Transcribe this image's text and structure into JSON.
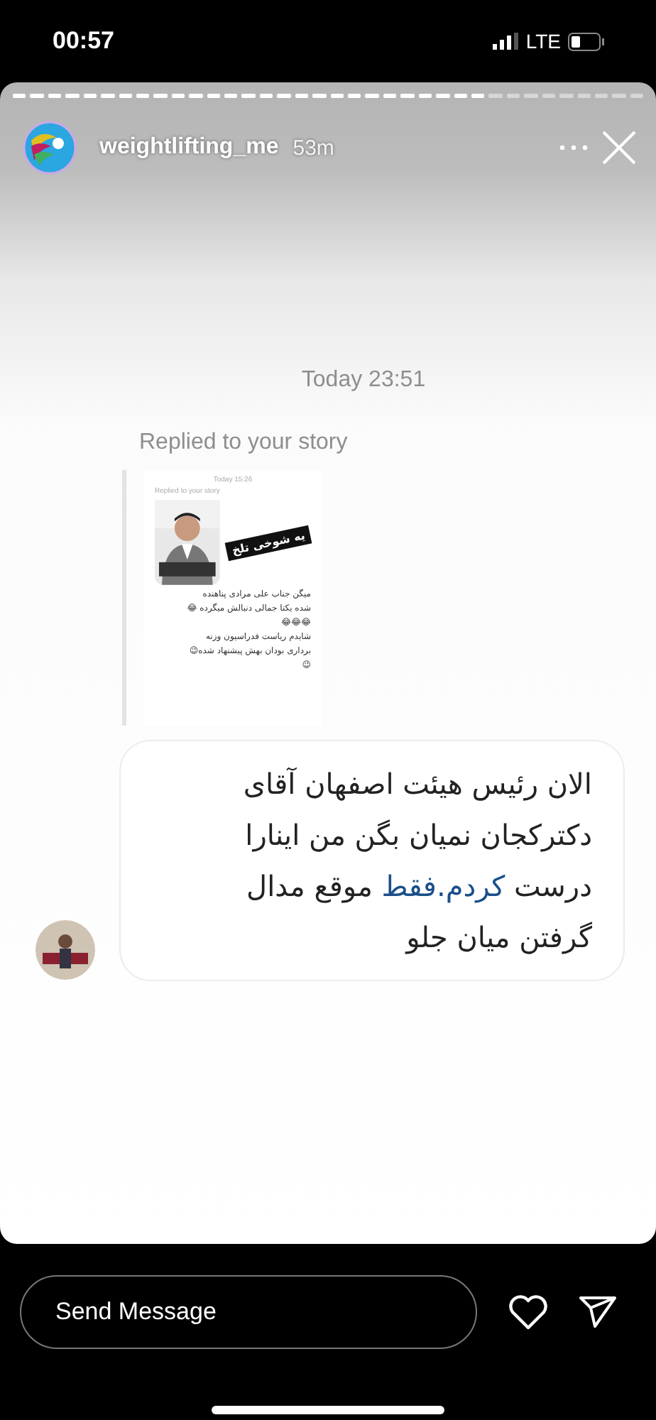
{
  "status_bar": {
    "time": "00:57",
    "network": "LTE"
  },
  "story": {
    "username": "weightlifting_me",
    "age": "53m"
  },
  "conversation": {
    "timestamp": "Today 23:51",
    "reply_label": "Replied to your story",
    "replied_story": {
      "timestamp": "Today 15:26",
      "reply_label": "Replied to your story",
      "sticker": "یه شوخی تلخ",
      "lines": [
        "میگن جناب علی مرادی  پناهنده",
        "شده یکتا جمالی دنبالش میگرده 😂",
        "😂😂😂",
        "شایدم ریاست فدراسیون وزنه",
        "برداری بودان بهش پیشنهاد شده😉",
        "😉"
      ]
    },
    "message": {
      "parts": [
        {
          "kind": "plain",
          "text": "الان رئیس هیئت اصفهان آقای دکترکجان نمیان بگن من اینارا درست "
        },
        {
          "kind": "link",
          "text": "کردم.فقط"
        },
        {
          "kind": "plain",
          "text": " موقع مدال گرفتن میان جلو"
        }
      ]
    }
  },
  "composer": {
    "placeholder": "Send Message"
  }
}
